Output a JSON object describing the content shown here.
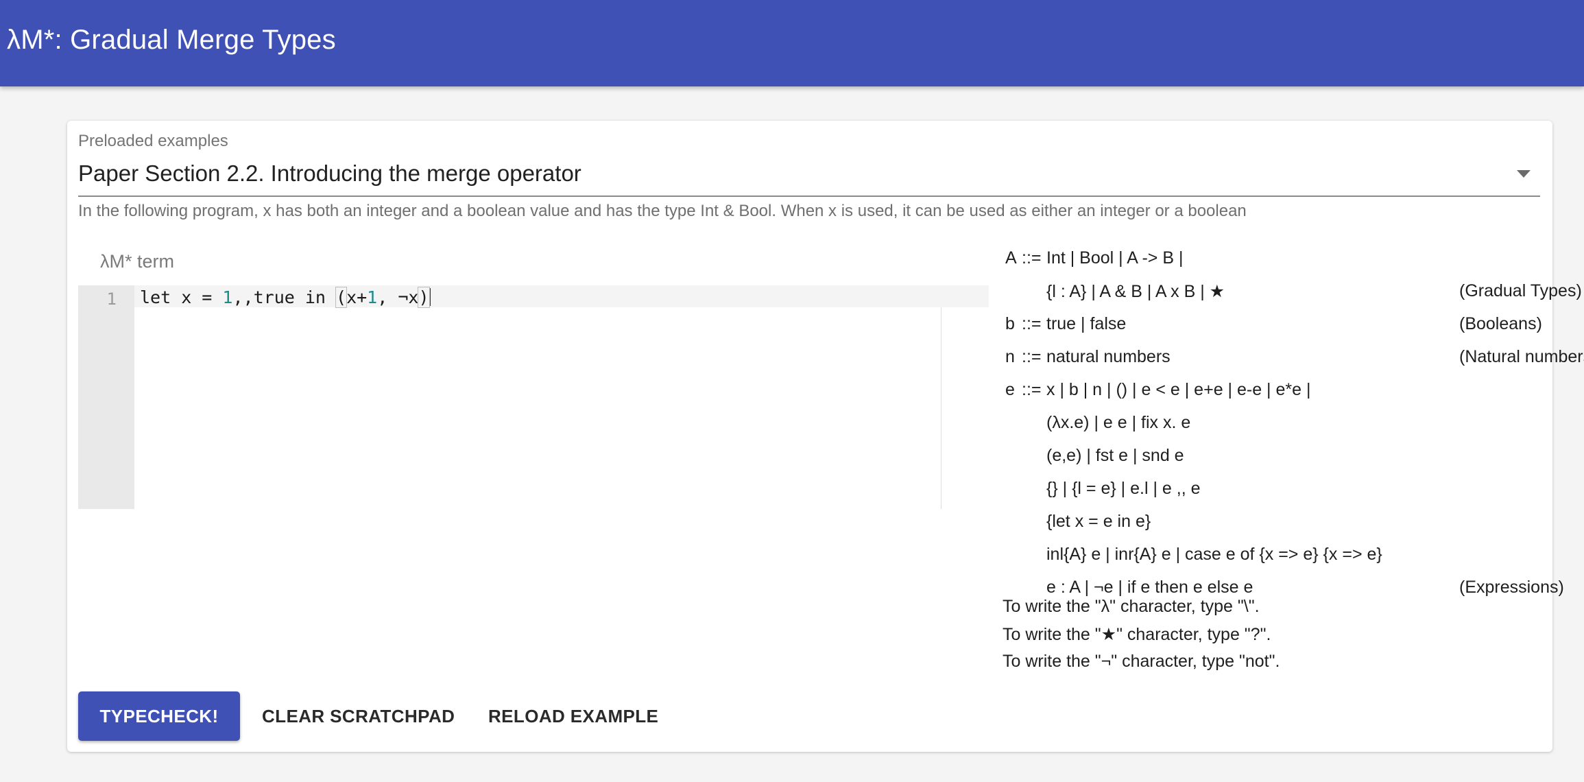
{
  "app": {
    "title": "λM*: Gradual Merge Types"
  },
  "examples": {
    "label": "Preloaded examples",
    "selected": "Paper Section 2.2. Introducing the merge operator",
    "helper": "In the following program, x has both an integer and a boolean value and has the type Int & Bool. When x is used, it can be used as either an integer or a boolean"
  },
  "editor": {
    "label": "λM* term",
    "line_number": "1",
    "code": {
      "t1": "let x = ",
      "n1": "1",
      "t2": ",,true in ",
      "b1": "(",
      "t3": "x+",
      "n2": "1",
      "t4": ", ¬x",
      "b2": ")"
    }
  },
  "grammar": {
    "rows": [
      {
        "nt": "A",
        "op": "::=",
        "rhs": "Int | Bool | A -> B |",
        "desc": ""
      },
      {
        "nt": "",
        "op": "",
        "rhs": "{l : A} | A & B | A x B | ★",
        "desc": "(Gradual Types)"
      },
      {
        "nt": "b",
        "op": "::=",
        "rhs": "true | false",
        "desc": "(Booleans)"
      },
      {
        "nt": "n",
        "op": "::=",
        "rhs": "natural numbers",
        "desc": "(Natural numbers)"
      },
      {
        "nt": "e",
        "op": "::=",
        "rhs": "x | b | n | () | e < e | e+e | e-e | e*e |",
        "desc": ""
      },
      {
        "nt": "",
        "op": "",
        "rhs": "(λx.e) | e e | fix x. e",
        "desc": ""
      },
      {
        "nt": "",
        "op": "",
        "rhs": "(e,e) | fst e | snd e",
        "desc": ""
      },
      {
        "nt": "",
        "op": "",
        "rhs": "{} | {l = e} | e.l | e ,, e",
        "desc": ""
      },
      {
        "nt": "",
        "op": "",
        "rhs": "{let x = e in e}",
        "desc": ""
      },
      {
        "nt": "",
        "op": "",
        "rhs": "inl{A} e | inr{A} e | case e of {x => e} {x => e}",
        "desc": ""
      },
      {
        "nt": "",
        "op": "",
        "rhs": "e : A | ¬e | if e then e else e",
        "desc": "(Expressions)"
      }
    ]
  },
  "notes": [
    "To write the \"λ\" character, type \"\\\".",
    "To write the \"★\" character, type \"?\".",
    "To write the \"¬\" character, type \"not\"."
  ],
  "buttons": {
    "typecheck": "TYPECHECK!",
    "clear": "CLEAR SCRATCHPAD",
    "reload": "RELOAD EXAMPLE"
  }
}
